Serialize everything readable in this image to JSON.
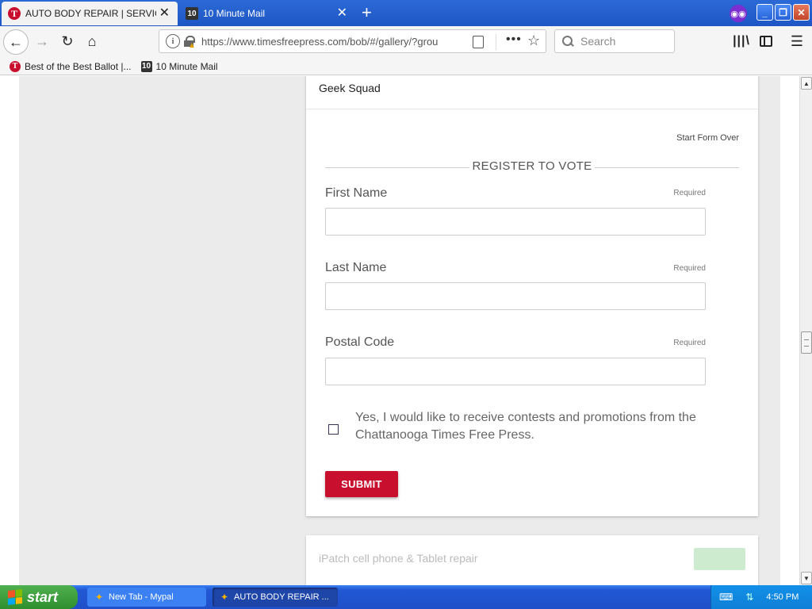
{
  "browser": {
    "tabs": [
      {
        "title": "AUTO BODY REPAIR | SERVICES",
        "icon": "times-free-press-icon",
        "active": true
      },
      {
        "title": "10 Minute Mail",
        "icon": "ten-minute-mail-icon",
        "active": false
      }
    ],
    "tab_icon_glyphs": {
      "tfp": "T",
      "ten": "10"
    },
    "new_tab": "+",
    "close_glyph": "✕",
    "url": "https://www.timesfreepress.com/bob/#/gallery/?grou",
    "search_placeholder": "Search",
    "bookmarks": [
      {
        "label": "Best of the Best Ballot |...",
        "icon": "times-free-press-icon"
      },
      {
        "label": "10 Minute Mail",
        "icon": "ten-minute-mail-icon"
      }
    ]
  },
  "card": {
    "nominee": "Geek Squad",
    "start_over": "Start Form Over",
    "heading": "REGISTER TO VOTE",
    "fields": [
      {
        "label": "First Name",
        "required": "Required",
        "value": ""
      },
      {
        "label": "Last Name",
        "required": "Required",
        "value": ""
      },
      {
        "label": "Postal Code",
        "required": "Required",
        "value": ""
      }
    ],
    "optin_text": "Yes, I would like to receive contests and promotions from the Chattanooga Times Free Press.",
    "optin_checked": false,
    "submit": "SUBMIT"
  },
  "next_card": {
    "nominee": "iPatch cell phone & Tablet repair"
  },
  "taskbar": {
    "start": "start",
    "tasks": [
      {
        "label": "New Tab - Mypal",
        "active": false
      },
      {
        "label": "AUTO BODY REPAIR ...",
        "active": true
      }
    ],
    "clock": "4:50 PM"
  },
  "colors": {
    "accent_red": "#c8102e",
    "tab_bar_blue": "#2b6ad6",
    "taskbar_blue": "#2258d4",
    "start_green": "#3a9a3a"
  }
}
